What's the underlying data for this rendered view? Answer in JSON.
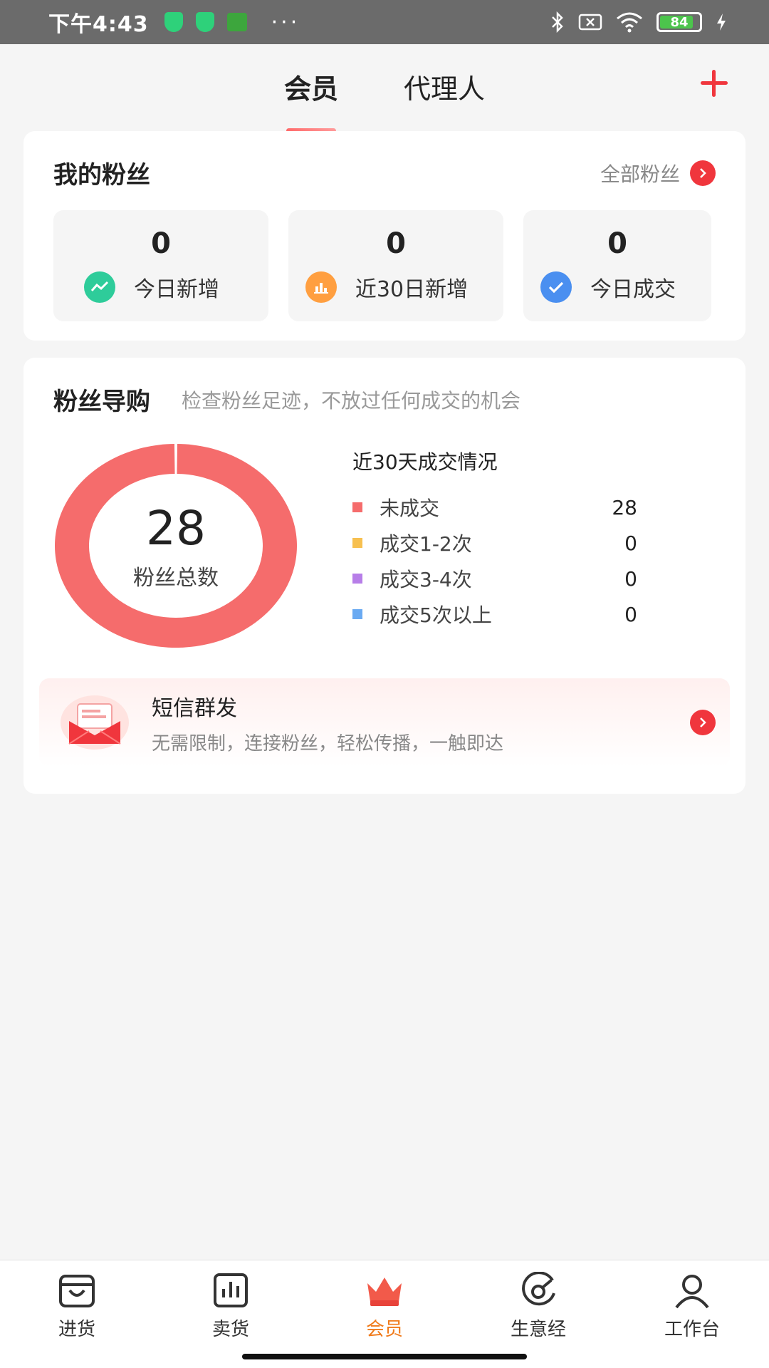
{
  "status_bar": {
    "time": "下午4:43",
    "dots": "···",
    "battery": "84",
    "app_icon_text": "🐸"
  },
  "tabs": [
    {
      "label": "会员",
      "active": true
    },
    {
      "label": "代理人",
      "active": false
    }
  ],
  "fans": {
    "title": "我的粉丝",
    "all_link": "全部粉丝",
    "stats": [
      {
        "value": "0",
        "label": "今日新增",
        "color": "#2ecc9a"
      },
      {
        "value": "0",
        "label": "近30日新增",
        "color": "#ff9f40"
      },
      {
        "value": "0",
        "label": "今日成交",
        "color": "#4a8ff0"
      }
    ]
  },
  "guide": {
    "title": "粉丝导购",
    "subtitle": "检查粉丝足迹，不放过任何成交的机会",
    "total": "28",
    "total_label": "粉丝总数",
    "legend_title": "近30天成交情况",
    "legend": [
      {
        "name": "未成交",
        "value": "28",
        "color": "#f56c6c"
      },
      {
        "name": "成交1-2次",
        "value": "0",
        "color": "#f7c050"
      },
      {
        "name": "成交3-4次",
        "value": "0",
        "color": "#b77ee8"
      },
      {
        "name": "成交5次以上",
        "value": "0",
        "color": "#6aaaf2"
      }
    ]
  },
  "chart_data": {
    "type": "pie",
    "categories": [
      "未成交",
      "成交1-2次",
      "成交3-4次",
      "成交5次以上"
    ],
    "values": [
      28,
      0,
      0,
      0
    ],
    "title": "近30天成交情况"
  },
  "sms": {
    "title": "短信群发",
    "desc": "无需限制，连接粉丝，轻松传播，一触即达"
  },
  "nav": [
    {
      "label": "进货",
      "icon": "bag-icon",
      "active": false
    },
    {
      "label": "卖货",
      "icon": "bar-chart-icon",
      "active": false
    },
    {
      "label": "会员",
      "icon": "crown-icon",
      "active": true
    },
    {
      "label": "生意经",
      "icon": "compass-icon",
      "active": false
    },
    {
      "label": "工作台",
      "icon": "person-icon",
      "active": false
    }
  ],
  "colors": {
    "accent": "#f0363d",
    "nav_active": "#f07a1a",
    "donut": "#f56c6c"
  }
}
